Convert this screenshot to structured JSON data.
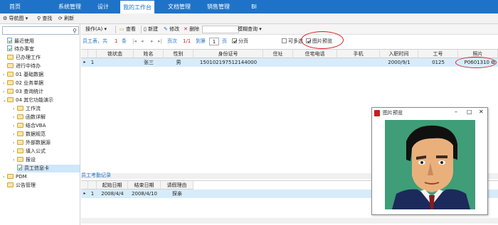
{
  "topnav": {
    "tabs": [
      "首页",
      "系统管理",
      "设计",
      "我的工作台",
      "文档管理",
      "销售管理",
      "BI"
    ],
    "active_index": 3
  },
  "toolbar2": {
    "nav_label": "导航图",
    "search_label": "查找",
    "refresh_label": "刷新"
  },
  "sidebar": {
    "items": [
      {
        "label": "最近使用",
        "icon": "doc-icon",
        "level": 1
      },
      {
        "label": "待办事宜",
        "icon": "doc-icon",
        "level": 1
      },
      {
        "label": "已办理工作",
        "icon": "folder-icon",
        "level": 1
      },
      {
        "label": "进行中待办",
        "icon": "folder-icon",
        "level": 1
      },
      {
        "label": "01 基础数据",
        "icon": "folder-icon",
        "level": 1
      },
      {
        "label": "02 业务单据",
        "icon": "folder-icon",
        "level": 1
      },
      {
        "label": "03 查询统计",
        "icon": "folder-icon",
        "level": 1
      },
      {
        "label": "04 其它功能演示",
        "icon": "folder-icon",
        "level": 1
      },
      {
        "label": "工作流",
        "icon": "folder-icon",
        "level": 2
      },
      {
        "label": "函数详解",
        "icon": "folder-icon",
        "level": 2
      },
      {
        "label": "结合VBA",
        "icon": "folder-icon",
        "level": 2
      },
      {
        "label": "数据规范",
        "icon": "folder-icon",
        "level": 2
      },
      {
        "label": "外部数据源",
        "icon": "folder-icon",
        "level": 2
      },
      {
        "label": "填入公式",
        "icon": "folder-icon",
        "level": 2
      },
      {
        "label": "报设",
        "icon": "folder-icon",
        "level": 2
      },
      {
        "label": "员工信息卡",
        "icon": "doc-icon",
        "level": 2
      },
      {
        "label": "PDM",
        "icon": "folder-icon",
        "level": 1
      },
      {
        "label": "公告管理",
        "icon": "folder-icon",
        "level": 1
      }
    ],
    "selected_index": 15
  },
  "maintoolbar": {
    "operate": "操作(A)",
    "view": "查看",
    "new": "新建",
    "edit": "修改",
    "delete": "删除",
    "fuzzy": "模糊查询"
  },
  "pager": {
    "table_name": "员工表，共",
    "count": "1",
    "count_unit": "条",
    "page_label": "页次",
    "page_value": "1/1",
    "goto_label": "到第",
    "goto_value": "1",
    "page_unit": "页",
    "paging_label": "分页",
    "multi_select_label": "可多选",
    "photo_preview_label": "图片预览"
  },
  "grid": {
    "columns": [
      "锁状态",
      "姓名",
      "性别",
      "身份证号",
      "住址",
      "住宅电话",
      "手机",
      "入职时间",
      "工号",
      "照片"
    ],
    "rows": [
      {
        "index": "1",
        "lock": "",
        "name": "张三",
        "gender": "男",
        "id_no": "150102197512144000",
        "address": "",
        "home_phone": "",
        "mobile": "",
        "hire_date": "2000/9/1",
        "emp_no": "0125",
        "photo": "P0601310"
      }
    ]
  },
  "attendance": {
    "title": "员工考勤记录",
    "columns": [
      "起始日期",
      "结束日期",
      "请假理由"
    ],
    "rows": [
      {
        "index": "1",
        "start": "2008/4/4",
        "end": "2008/4/10",
        "reason": "探亲"
      }
    ]
  },
  "popup": {
    "title": "图片预览",
    "minimize": "–",
    "maximize": "□",
    "close": "✕"
  }
}
